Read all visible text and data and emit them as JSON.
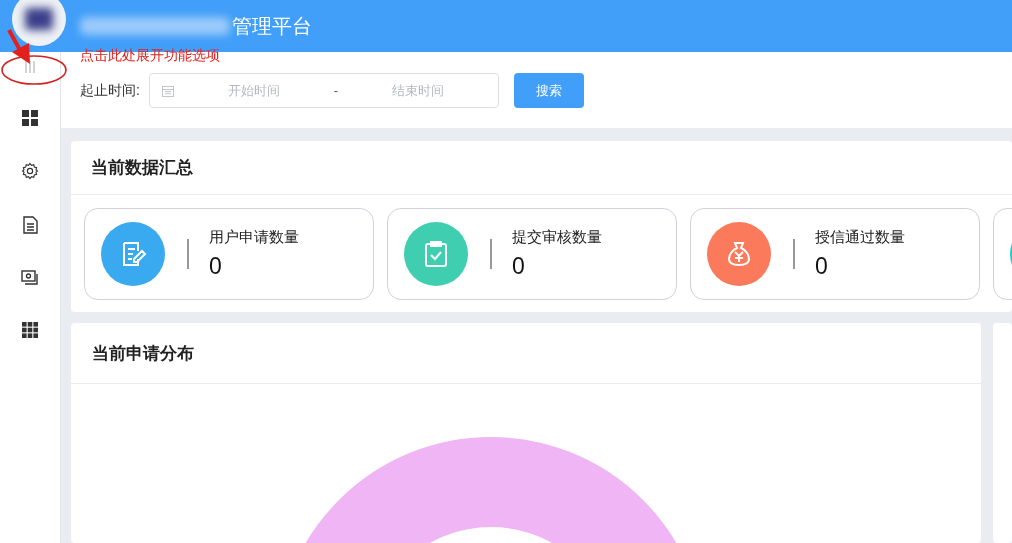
{
  "header": {
    "title": "管理平台"
  },
  "annotation": {
    "text": "点击此处展开功能选项"
  },
  "sidebar": {
    "items": [
      {
        "kind": "toggle"
      },
      {
        "kind": "dashboard"
      },
      {
        "kind": "settings"
      },
      {
        "kind": "document"
      },
      {
        "kind": "photos"
      },
      {
        "kind": "apps"
      }
    ]
  },
  "filter": {
    "label": "起止时间:",
    "start_placeholder": "开始时间",
    "separator": "-",
    "end_placeholder": "结束时间",
    "button": "搜索"
  },
  "summary": {
    "title": "当前数据汇总",
    "stats": [
      {
        "kind": "apply",
        "color": "#3aaaf0",
        "label": "用户申请数量",
        "value": "0"
      },
      {
        "kind": "review",
        "color": "#3fcfb0",
        "label": "提交审核数量",
        "value": "0"
      },
      {
        "kind": "credit",
        "color": "#fb7a5c",
        "label": "授信通过数量",
        "value": "0"
      },
      {
        "kind": "partial",
        "color": "#2cc6d8"
      }
    ]
  },
  "distribution": {
    "title": "当前申请分布"
  }
}
